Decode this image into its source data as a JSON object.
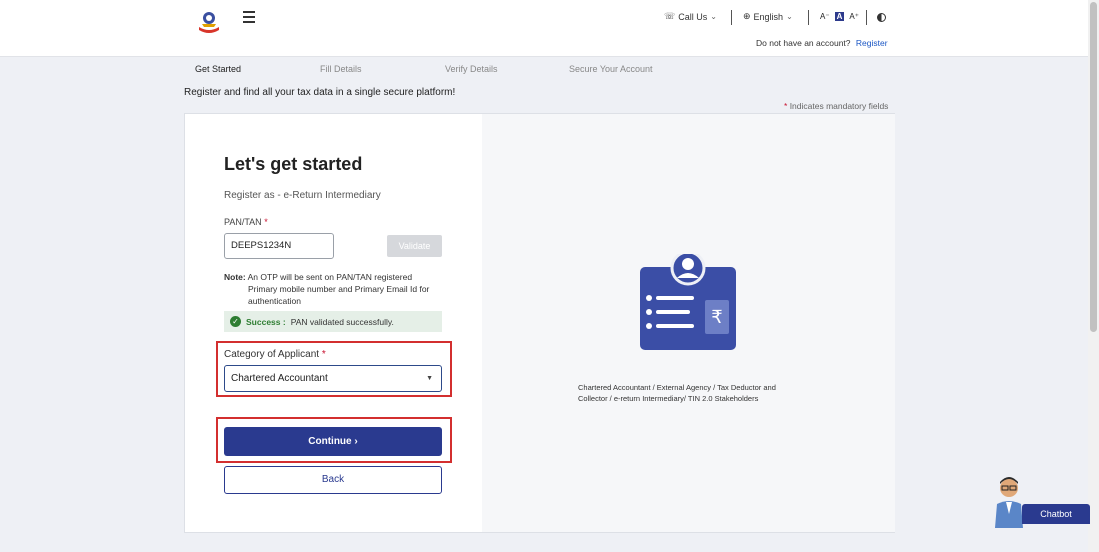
{
  "header": {
    "call_us": "Call Us",
    "language": "English",
    "font_small": "A",
    "font_normal": "A",
    "font_large": "A",
    "no_account": "Do not have an account?",
    "register": "Register"
  },
  "steps": [
    "Get Started",
    "Fill Details",
    "Verify Details",
    "Secure Your Account"
  ],
  "intro": "Register and find all your tax data in a single secure platform!",
  "mandatory_star": "*",
  "mandatory": "Indicates mandatory fields",
  "form": {
    "title": "Let's get started",
    "register_as": "Register as - e-Return Intermediary",
    "pan_label": "PAN/TAN",
    "pan_value": "DEEPS1234N",
    "validate": "Validate",
    "note_label": "Note:",
    "note_text_1": "An OTP will be sent on PAN/TAN registered",
    "note_text_2": "Primary mobile number and Primary Email Id for",
    "note_text_3": "authentication",
    "success_label": "Success :",
    "success_text": "PAN validated successfully.",
    "category_label": "Category of Applicant",
    "category_value": "Chartered Accountant",
    "continue": "Continue ›",
    "back": "Back"
  },
  "illustration": {
    "desc_1": "Chartered Accountant / External Agency / Tax Deductor and",
    "desc_2": "Collector / e-return Intermediary/ TIN 2.0 Stakeholders"
  },
  "chatbot": "Chatbot",
  "colors": {
    "primary": "#2a3a8f",
    "highlight": "#d32f2f",
    "success": "#2e7d32"
  }
}
